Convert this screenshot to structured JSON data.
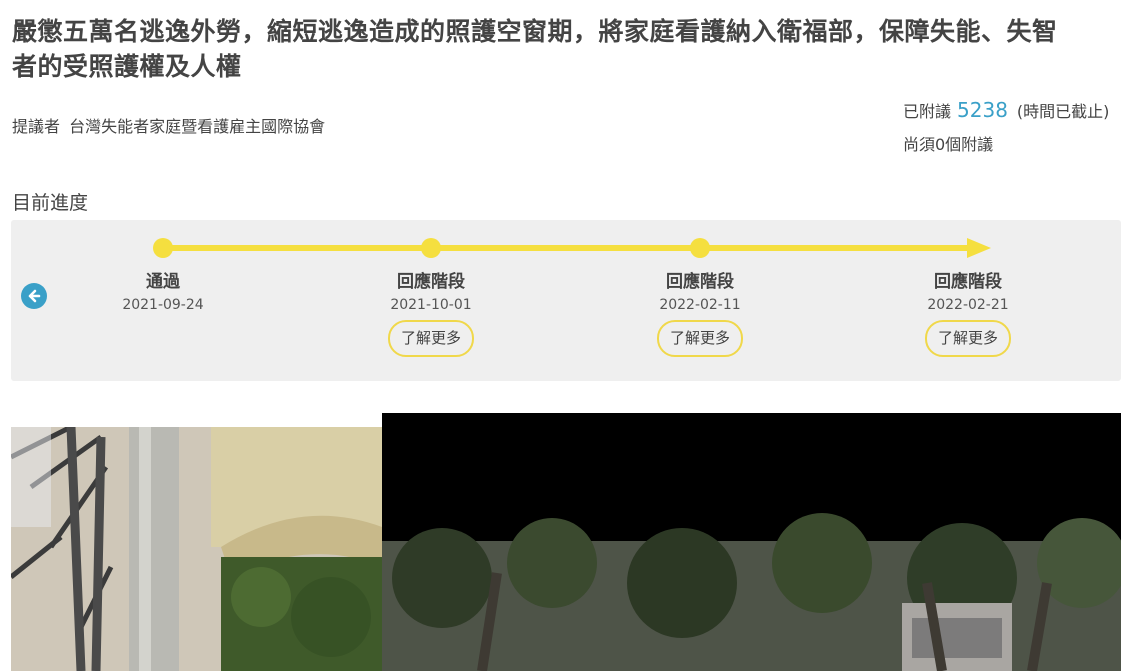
{
  "petition": {
    "title": "嚴懲五萬名逃逸外勞，縮短逃逸造成的照護空窗期，將家庭看護納入衛福部，保障失能、失智者的受照護權及人權",
    "proposer_label": "提議者",
    "proposer_name": "台灣失能者家庭暨看護雇主國際協會"
  },
  "signatures": {
    "label": "已附議",
    "count": "5238",
    "status_note": "(時間已截止)",
    "remaining": "尚須0個附議"
  },
  "progress": {
    "section_label": "目前進度",
    "stages": [
      {
        "name": "通過",
        "date": "2021-09-24",
        "button": ""
      },
      {
        "name": "回應階段",
        "date": "2021-10-01",
        "button": "了解更多"
      },
      {
        "name": "回應階段",
        "date": "2022-02-11",
        "button": "了解更多"
      },
      {
        "name": "回應階段",
        "date": "2022-02-21",
        "button": "了解更多"
      }
    ]
  },
  "colors": {
    "accent_blue": "#3aa0c8",
    "timeline_yellow": "#f5df3f",
    "panel_bg": "#efefef"
  },
  "icons": {
    "back": "arrow-left-circle-icon"
  }
}
